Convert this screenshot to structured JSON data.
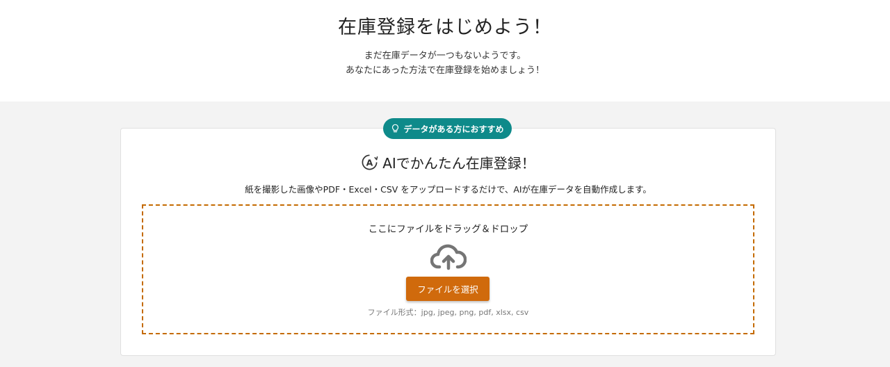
{
  "header": {
    "title": "在庫登録をはじめよう！",
    "subtitle_line1": "まだ在庫データが一つもないようです。",
    "subtitle_line2": "あなたにあった方法で在庫登録を始めましょう！"
  },
  "card": {
    "badge": "データがある方におすすめ",
    "title": "AIでかんたん在庫登録！",
    "description": "紙を撮影した画像やPDF・Excel・CSV をアップロードするだけで、AIが在庫データを自動作成します。",
    "dropzone": {
      "text": "ここにファイルをドラッグ＆ドロップ",
      "button_label": "ファイルを選択",
      "formats": "ファイル形式：jpg, jpeg, png, pdf, xlsx, csv"
    }
  },
  "colors": {
    "badge": "#0e8a8a",
    "button": "#d06a0c",
    "dropzone_border": "#c46a00"
  },
  "icons": {
    "badge": "lightbulb-icon",
    "title": "ai-circle-icon",
    "upload": "cloud-upload-icon"
  }
}
